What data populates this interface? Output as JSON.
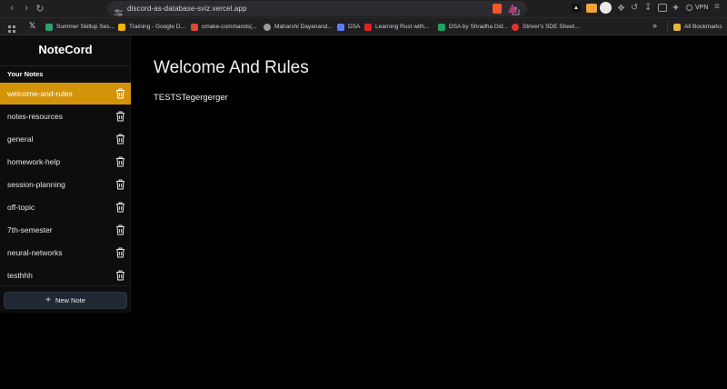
{
  "browser": {
    "url": "discord-as-database-sviz.vercel.app",
    "bookmarks": [
      {
        "label": "Summer Skillup Ses...",
        "color": "#2aa46b"
      },
      {
        "label": "Training - Google D...",
        "color": "#f4b400"
      },
      {
        "label": "cmake-commands(...",
        "color": "#d44c2e"
      },
      {
        "label": "Maharshi Dayanand...",
        "color": "#9b9b9b"
      },
      {
        "label": "DSA",
        "color": "#5b7cfa"
      },
      {
        "label": "Learning Rust with...",
        "color": "#e02424"
      },
      {
        "label": "DSA by Shradha Did...",
        "color": "#1fa463"
      },
      {
        "label": "Striver's SDE Sheet...",
        "color": "#e0342e"
      }
    ],
    "all_bookmarks": "All Bookmarks",
    "vpn": "VPN"
  },
  "sidebar": {
    "brand": "NoteCord",
    "section_title": "Your Notes",
    "notes": [
      {
        "label": "welcome-and-rules",
        "active": true
      },
      {
        "label": "notes-resources",
        "active": false
      },
      {
        "label": "general",
        "active": false
      },
      {
        "label": "homework-help",
        "active": false
      },
      {
        "label": "session-planning",
        "active": false
      },
      {
        "label": "off-topic",
        "active": false
      },
      {
        "label": "7th-semester",
        "active": false
      },
      {
        "label": "neural-networks",
        "active": false
      },
      {
        "label": "testhhh",
        "active": false
      }
    ],
    "new_note_label": "New Note"
  },
  "main": {
    "title": "Welcome And Rules",
    "body": "TESTSTegergerger"
  },
  "colors": {
    "accent": "#d4940a",
    "background": "#000000",
    "sidebar": "#0d0d0d",
    "button": "#222833"
  }
}
